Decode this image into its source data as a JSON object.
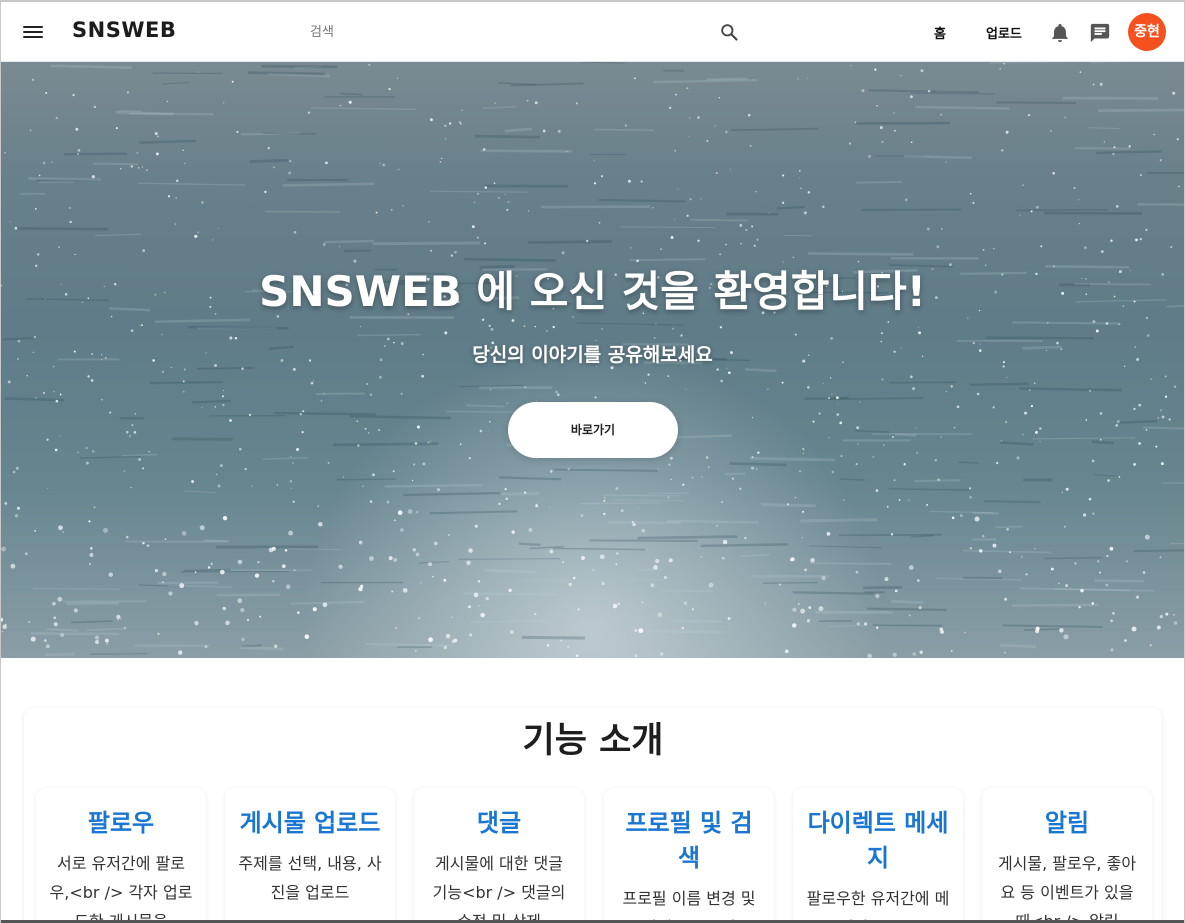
{
  "header": {
    "logo": "SNSWEB",
    "search_placeholder": "검색",
    "nav_home": "홈",
    "nav_upload": "업로드",
    "avatar_text": "중현",
    "avatar_color": "#f4511e"
  },
  "hero": {
    "title": "SNSWEB 에 오신 것을 환영합니다!",
    "subtitle": "당신의 이야기를 공유해보세요",
    "button_label": "바로가기"
  },
  "features": {
    "title": "기능 소개",
    "accent_color": "#1976d2",
    "items": [
      {
        "title": "팔로우",
        "desc": "서로 유저간에 팔로우,<br /> 각자 업로드한 게시물을"
      },
      {
        "title": "게시물 업로드",
        "desc": "주제를 선택, 내용, 사진을 업로드"
      },
      {
        "title": "댓글",
        "desc": "게시물에 대한 댓글 기능<br /> 댓글의 수정 및 삭제"
      },
      {
        "title": "프로필 및 검색",
        "desc": "프로필 이름 변경 및 검색으로 유저"
      },
      {
        "title": "다이렉트 메세지",
        "desc": "팔로우한 유저간에 메세지를 주고"
      },
      {
        "title": "알림",
        "desc": "게시물, 팔로우, 좋아요 등 이벤트가 있을 때<br /> 알림"
      }
    ]
  }
}
